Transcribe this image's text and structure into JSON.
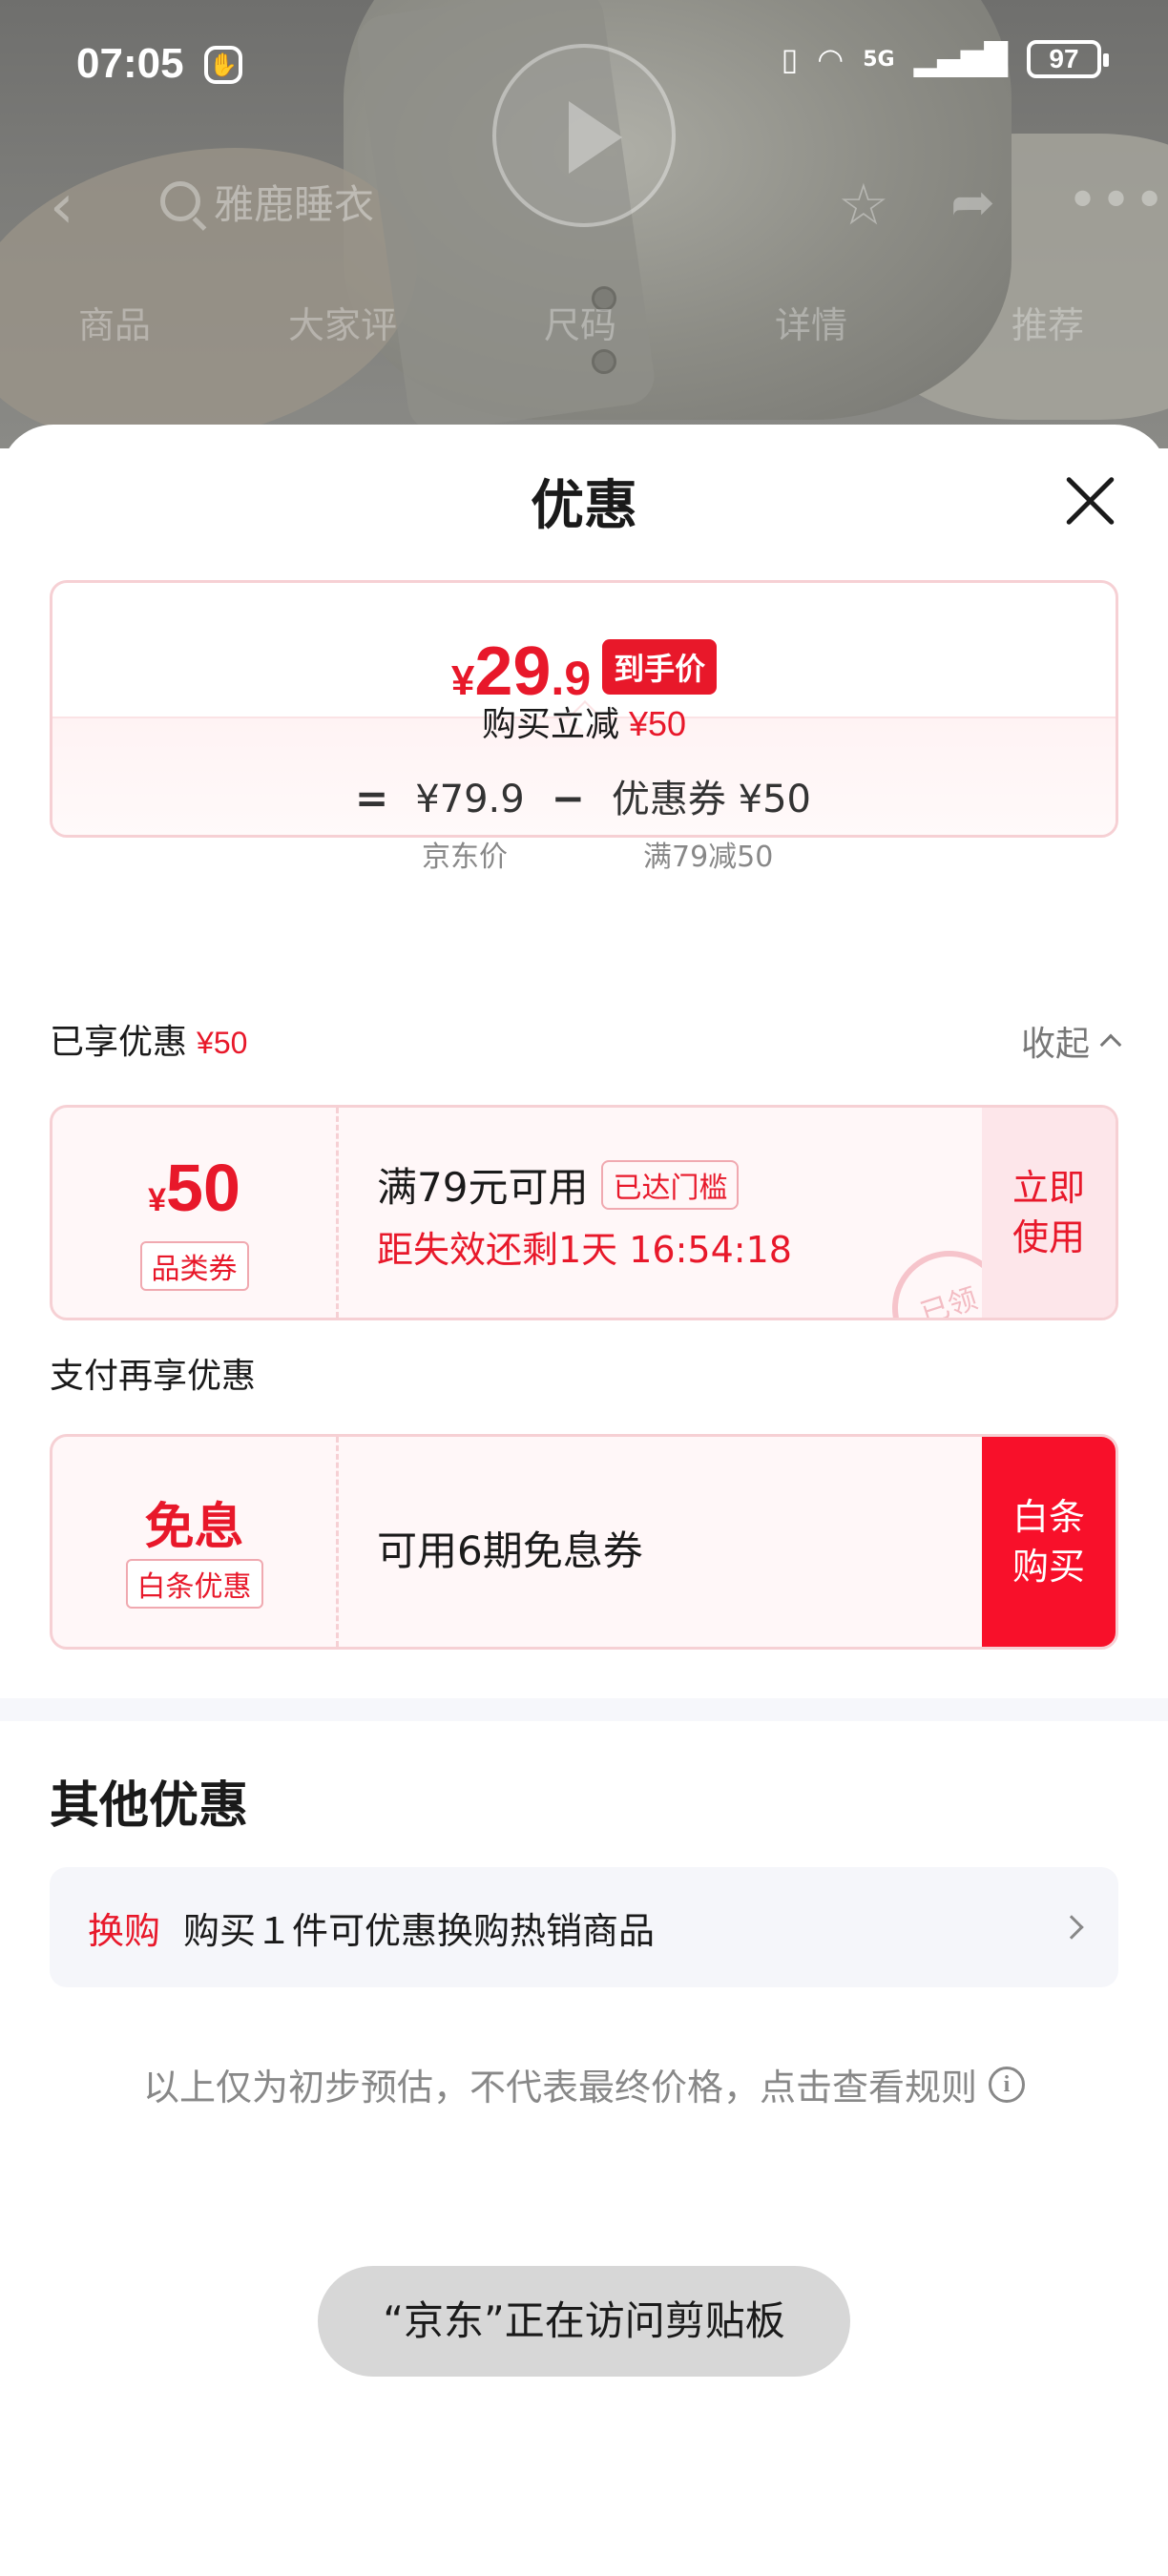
{
  "status_bar": {
    "time": "07:05",
    "network": "5G",
    "battery": "97"
  },
  "background_page": {
    "search_query": "雅鹿睡衣",
    "tabs": [
      "商品",
      "大家评",
      "尺码",
      "详情",
      "推荐"
    ]
  },
  "sheet": {
    "title": "优惠",
    "price_card": {
      "currency": "¥",
      "final_price_int": "29",
      "final_price_dec": ".9",
      "final_badge": "到手价",
      "save_label": "购买立减",
      "save_amount": "¥50",
      "formula": {
        "equals": "=",
        "jd_price": "¥79.9",
        "minus": "−",
        "coupon_label": "优惠券 ¥50",
        "jd_price_caption": "京东价",
        "coupon_caption": "满79减50"
      }
    },
    "enjoyed": {
      "label": "已享优惠",
      "amount": "¥50",
      "collapse_label": "收起"
    },
    "coupon1": {
      "currency": "¥",
      "amount": "50",
      "type_tag": "品类券",
      "title": "满79元可用",
      "threshold_pill": "已达门槛",
      "countdown": "距失效还剩1天 16:54:18",
      "action": "立即使用",
      "stamp": "已领"
    },
    "pay_section_label": "支付再享优惠",
    "coupon2": {
      "title": "免息",
      "type_tag": "白条优惠",
      "text": "可用6期免息券",
      "action": "白条购买"
    },
    "other": {
      "title": "其他优惠",
      "swap_label": "换购",
      "swap_text": "购买１件可优惠换购热销商品"
    },
    "disclaimer": "以上仅为初步预估，不代表最终价格，点击查看规则",
    "toast": "“京东”正在访问剪贴板"
  },
  "colors": {
    "accent": "#e8182a",
    "accent_bg": "#fff7f8",
    "border": "#f6d0d4"
  }
}
